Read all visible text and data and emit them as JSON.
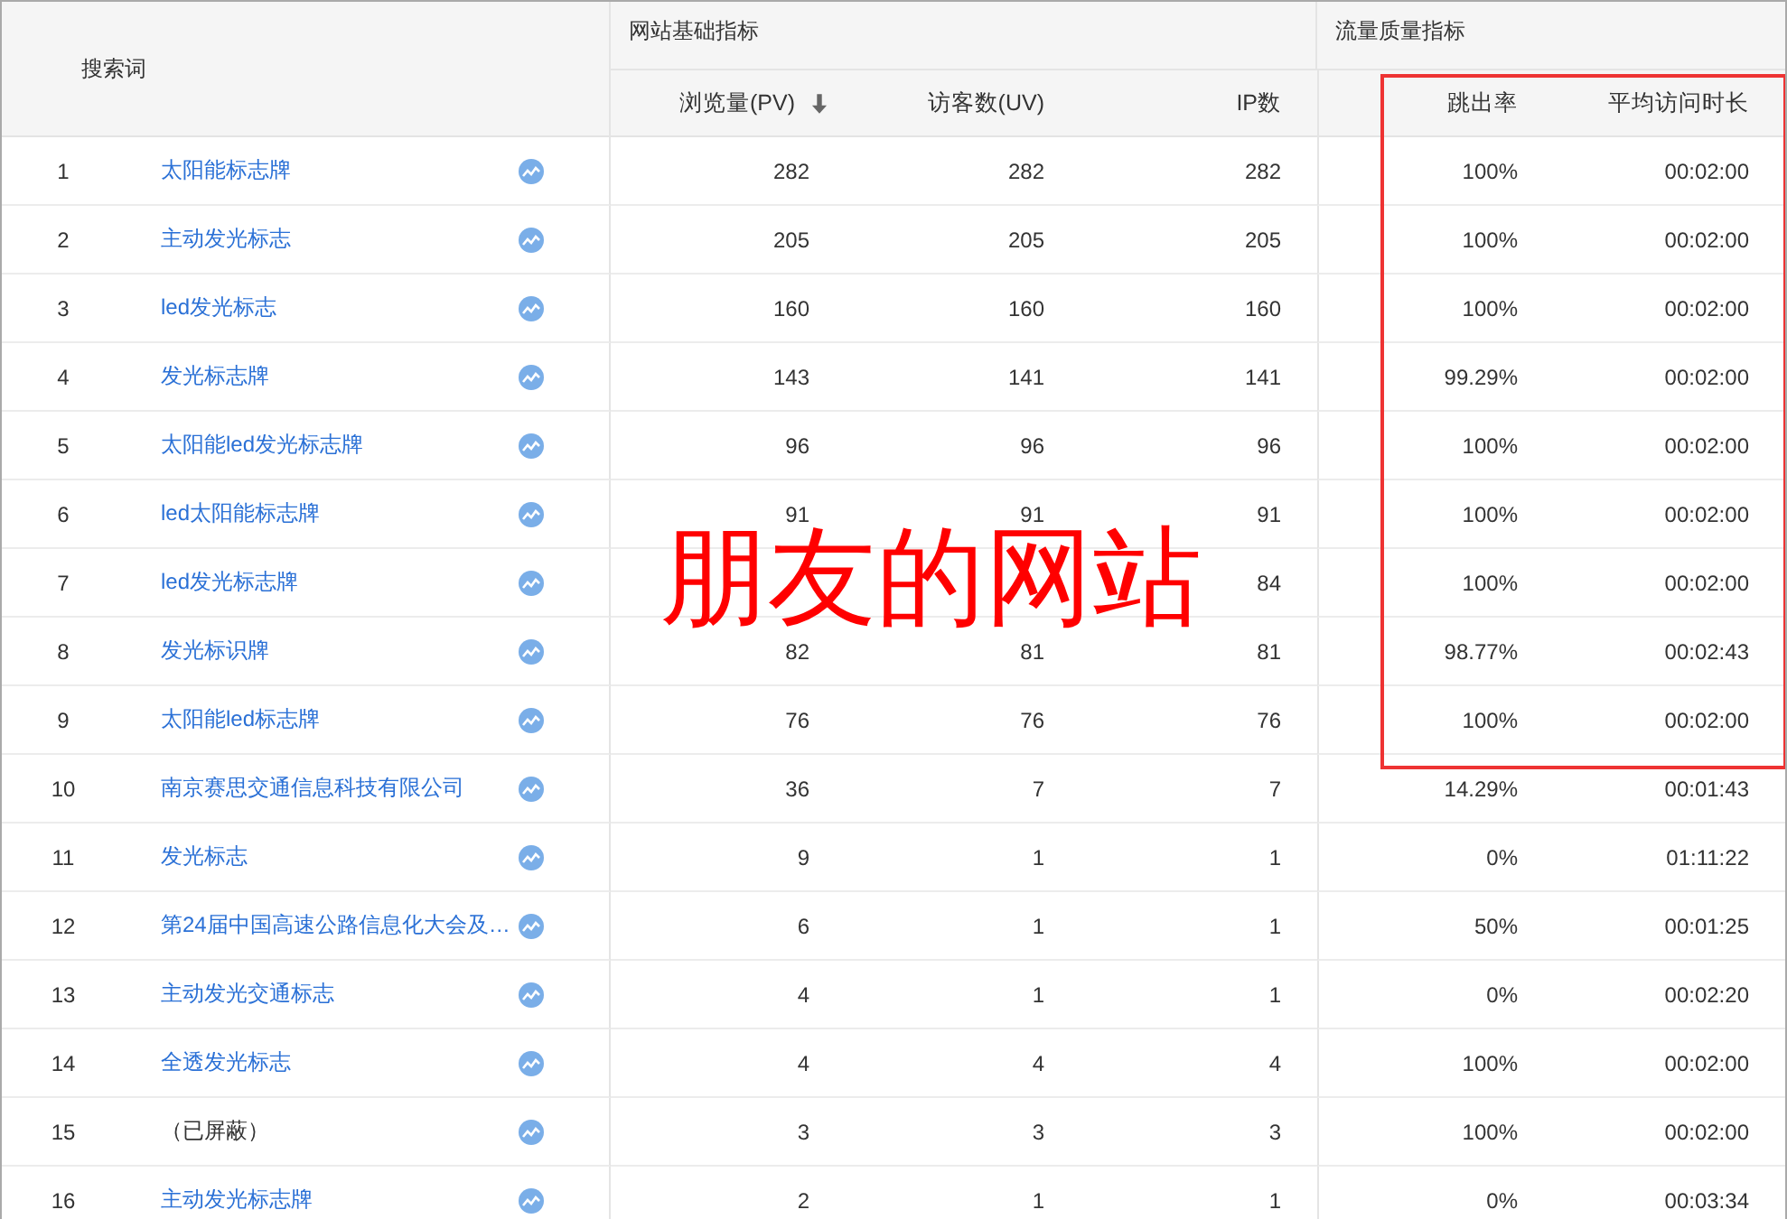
{
  "table": {
    "keyword_header": "搜索词",
    "groups": [
      {
        "label": "网站基础指标"
      },
      {
        "label": "流量质量指标"
      }
    ],
    "columns": [
      {
        "label": "浏览量(PV)",
        "sorted": true
      },
      {
        "label": "访客数(UV)",
        "sorted": false
      },
      {
        "label": "IP数",
        "sorted": false
      },
      {
        "label": "跳出率",
        "sorted": false
      },
      {
        "label": "平均访问时长",
        "sorted": false
      }
    ],
    "rows": [
      {
        "rank": "1",
        "keyword": "太阳能标志牌",
        "kind": "link",
        "values": [
          "282",
          "282",
          "282",
          "100%",
          "00:02:00"
        ]
      },
      {
        "rank": "2",
        "keyword": "主动发光标志",
        "kind": "link",
        "values": [
          "205",
          "205",
          "205",
          "100%",
          "00:02:00"
        ]
      },
      {
        "rank": "3",
        "keyword": "led发光标志",
        "kind": "link",
        "values": [
          "160",
          "160",
          "160",
          "100%",
          "00:02:00"
        ]
      },
      {
        "rank": "4",
        "keyword": "发光标志牌",
        "kind": "link",
        "values": [
          "143",
          "141",
          "141",
          "99.29%",
          "00:02:00"
        ]
      },
      {
        "rank": "5",
        "keyword": "太阳能led发光标志牌",
        "kind": "link",
        "values": [
          "96",
          "96",
          "96",
          "100%",
          "00:02:00"
        ]
      },
      {
        "rank": "6",
        "keyword": "led太阳能标志牌",
        "kind": "link",
        "values": [
          "91",
          "91",
          "91",
          "100%",
          "00:02:00"
        ]
      },
      {
        "rank": "7",
        "keyword": "led发光标志牌",
        "kind": "link",
        "values": {
          "ip": "84",
          "bounce_rate": "100%",
          "avg_duration": "00:02:00"
        }
      },
      {
        "rank": "8",
        "keyword": "发光标识牌",
        "kind": "link",
        "values": [
          "82",
          "81",
          "81",
          "98.77%",
          "00:02:43"
        ]
      },
      {
        "rank": "9",
        "keyword": "太阳能led标志牌",
        "kind": "link",
        "values": [
          "76",
          "76",
          "76",
          "100%",
          "00:02:00"
        ]
      },
      {
        "rank": "10",
        "keyword": "南京赛思交通信息科技有限公司",
        "kind": "link",
        "values": [
          "36",
          "7",
          "7",
          "14.29%",
          "00:01:43"
        ]
      },
      {
        "rank": "11",
        "keyword": "发光标志",
        "kind": "link",
        "values": [
          "9",
          "1",
          "1",
          "0%",
          "01:11:22"
        ]
      },
      {
        "rank": "12",
        "keyword": "第24届中国高速公路信息化大会及…",
        "kind": "link",
        "values": [
          "6",
          "1",
          "1",
          "50%",
          "00:01:25"
        ]
      },
      {
        "rank": "13",
        "keyword": "主动发光交通标志",
        "kind": "link",
        "values": [
          "4",
          "1",
          "1",
          "0%",
          "00:02:20"
        ]
      },
      {
        "rank": "14",
        "keyword": "全透发光标志",
        "kind": "link",
        "values": [
          "4",
          "4",
          "4",
          "100%",
          "00:02:00"
        ]
      },
      {
        "rank": "15",
        "keyword": "（已屏蔽）",
        "kind": "plain",
        "values": [
          "3",
          "3",
          "3",
          "100%",
          "00:02:00"
        ]
      },
      {
        "rank": "16",
        "keyword": "主动发光标志牌",
        "kind": "link",
        "values": [
          "2",
          "1",
          "1",
          "0%",
          "00:03:34"
        ]
      }
    ]
  },
  "annotation": {
    "text": "朋友的网站",
    "highlight_box": true
  }
}
